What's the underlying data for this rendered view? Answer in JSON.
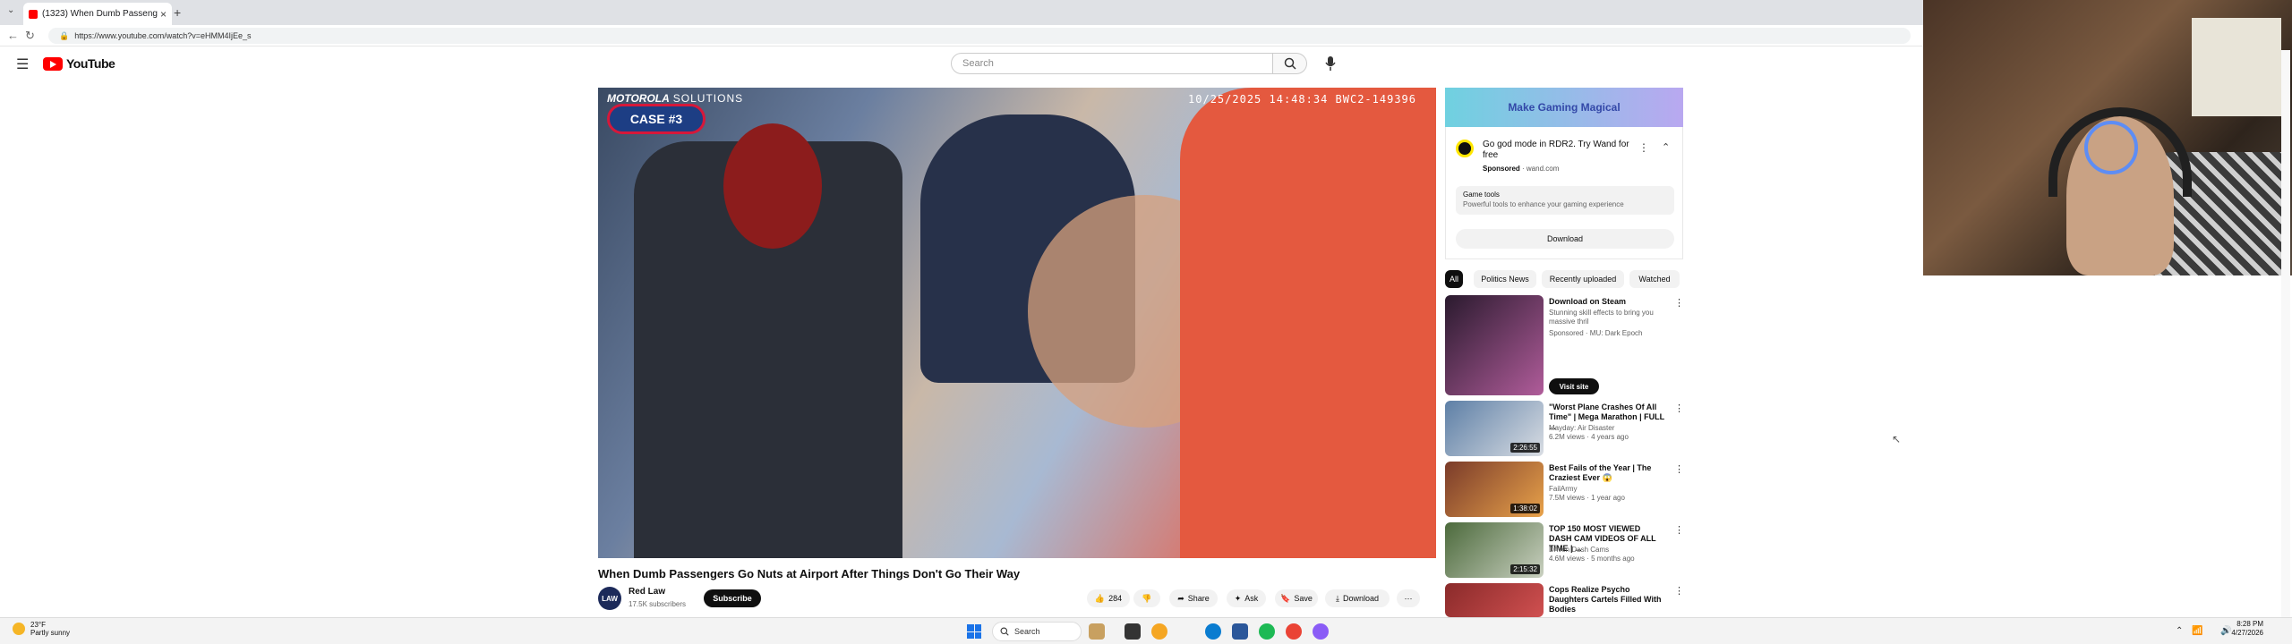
{
  "browser": {
    "tab_title": "(1323) When Dumb Passeng",
    "url": "https://www.youtube.com/watch?v=eHMM4IjEe_s"
  },
  "header": {
    "logo_text": "YouTube",
    "search_placeholder": "Search"
  },
  "video": {
    "brand_bold": "MOTOROLA",
    "brand_thin": "SOLUTIONS",
    "case_label": "CASE #3",
    "timestamp": "10/25/2025 14:48:34 BWC2-149396",
    "title": "When Dumb Passengers Go Nuts at Airport After Things Don't Go Their Way",
    "channel_avatar": "LAW",
    "channel_name": "Red Law",
    "subscribers": "17.5K subscribers",
    "subscribe_label": "Subscribe",
    "likes": "284",
    "share_label": "Share",
    "ask_label": "Ask",
    "save_label": "Save",
    "download_label": "Download"
  },
  "ad": {
    "banner": "Make Gaming Magical",
    "title": "Go god mode in RDR2. Try Wand for free",
    "sponsored": "Sponsored",
    "domain": "wand.com",
    "box_title": "Game tools",
    "box_sub": "Powerful tools to enhance your gaming experience",
    "download": "Download"
  },
  "chips": [
    "All",
    "Politics News",
    "Recently uploaded",
    "Watched"
  ],
  "recommendations": [
    {
      "title": "Download on Steam",
      "channel": "Stunning skill effects to bring you massive thril",
      "meta": "Sponsored · MU: Dark Epoch",
      "duration": "",
      "visit": "Visit site",
      "thumb_colors": [
        "#2a1a2e",
        "#b05c9a"
      ]
    },
    {
      "title": "\"Worst Plane Crashes Of All Time\" | Mega Marathon | FULL ...",
      "channel": "Mayday: Air Disaster",
      "meta": "6.2M views · 4 years ago",
      "duration": "2:26:55",
      "thumb_colors": [
        "#5d7fa6",
        "#d9dde3"
      ]
    },
    {
      "title": "Best Fails of the Year | The Craziest Ever 😱",
      "channel": "FailArmy",
      "meta": "7.5M views · 1 year ago",
      "duration": "1:38:02",
      "thumb_colors": [
        "#7a3b2a",
        "#e8a24a"
      ]
    },
    {
      "title": "TOP 150 MOST VIEWED DASH CAM VIDEOS OF ALL TIME | ...",
      "channel": "Driven Dash Cams",
      "meta": "4.6M views · 5 months ago",
      "duration": "2:15:32",
      "thumb_colors": [
        "#4c6a3c",
        "#c9d0c0"
      ]
    },
    {
      "title": "Cops Realize Psycho Daughters Cartels Filled With Bodies",
      "channel": "",
      "meta": "",
      "duration": "",
      "thumb_colors": [
        "#8a2a2a",
        "#d05050"
      ]
    }
  ],
  "taskbar": {
    "temp": "23°F",
    "condition": "Partly sunny",
    "search": "Search",
    "time": "8:28 PM",
    "date": "4/27/2026"
  },
  "colors": {
    "youtube_red": "#ff0000",
    "case_border": "#d6183a",
    "case_bg": "#1d3e84"
  }
}
